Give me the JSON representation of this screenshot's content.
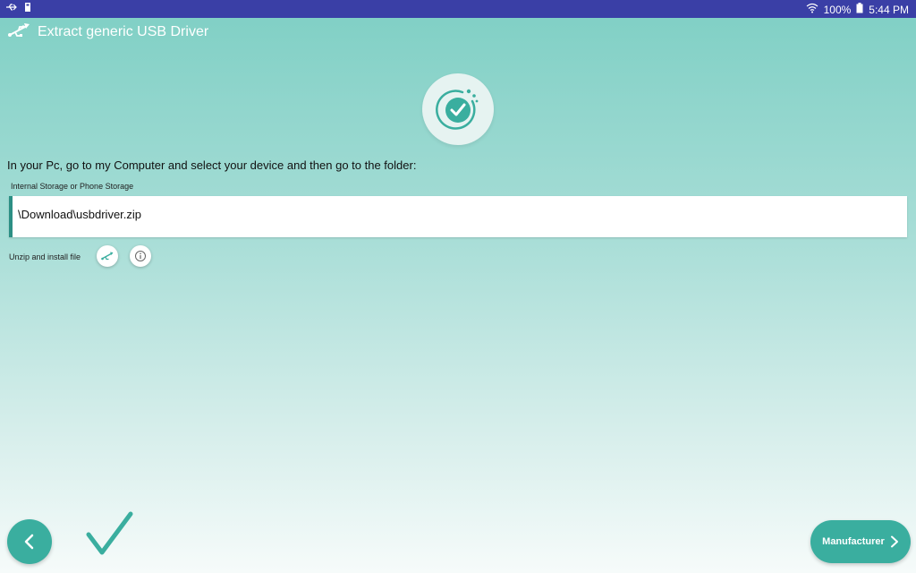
{
  "status_bar": {
    "battery": "100%",
    "time": "5:44 PM"
  },
  "app": {
    "title": "Extract generic USB Driver"
  },
  "main": {
    "instruction": "In your Pc, go to my Computer and select your device and then go to the folder:",
    "storage_label": "Internal Storage or Phone Storage",
    "path": "\\Download\\usbdriver.zip",
    "unzip_label": "Unzip and install file"
  },
  "footer": {
    "manufacturer_label": "Manufacturer"
  },
  "colors": {
    "status_bar": "#3a3fa6",
    "accent": "#3aae9f",
    "path_border": "#2c8f84"
  },
  "icons": [
    "usb-icon",
    "wifi-icon",
    "battery-icon",
    "check-icon",
    "info-icon",
    "chevron-left-icon",
    "chevron-right-icon"
  ]
}
